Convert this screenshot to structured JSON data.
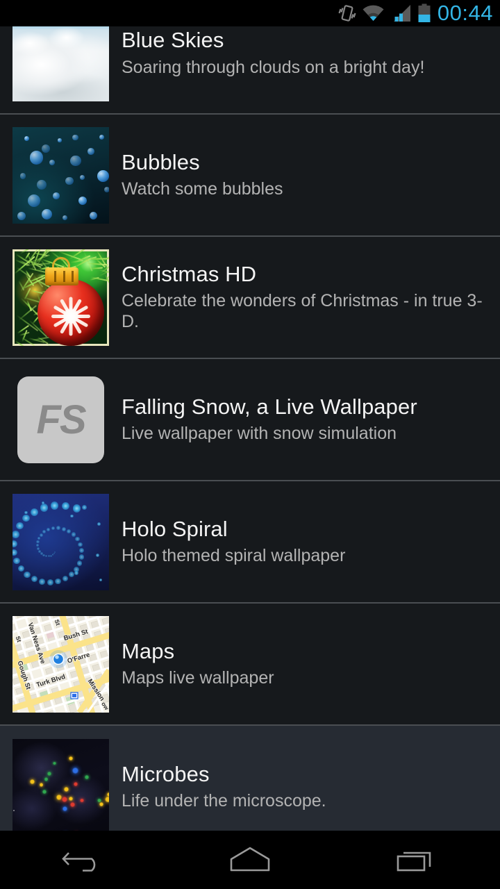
{
  "statusbar": {
    "clock": "00:44",
    "icons": [
      {
        "name": "vibrate-icon",
        "label": "vibrate"
      },
      {
        "name": "wifi-icon",
        "label": "wifi"
      },
      {
        "name": "cellular-signal-icon",
        "label": "signal"
      },
      {
        "name": "battery-icon",
        "label": "battery"
      }
    ],
    "accent_color": "#33b5e5",
    "battery_level_percent": 45
  },
  "list": {
    "items": [
      {
        "title": "Blue Skies",
        "subtitle": "Soaring through clouds on a bright day!",
        "thumb": "blue-skies-thumbnail",
        "selected": false
      },
      {
        "title": "Bubbles",
        "subtitle": "Watch some bubbles",
        "thumb": "bubbles-thumbnail",
        "selected": false
      },
      {
        "title": "Christmas HD",
        "subtitle": "Celebrate the wonders of Christmas - in true 3-D.",
        "thumb": "christmas-hd-thumbnail",
        "selected": false
      },
      {
        "title": "Falling Snow, a Live Wallpaper",
        "subtitle": "Live wallpaper with snow simulation",
        "thumb": "falling-snow-thumbnail",
        "icon_text": "FS",
        "selected": false
      },
      {
        "title": "Holo Spiral",
        "subtitle": "Holo themed spiral wallpaper",
        "thumb": "holo-spiral-thumbnail",
        "selected": false
      },
      {
        "title": "Maps",
        "subtitle": "Maps live wallpaper",
        "thumb": "maps-thumbnail",
        "map_labels": [
          "St",
          "Van Ness Ave",
          "Bush St",
          "O'Farre",
          "Turk Blvd",
          "Gough St",
          "Mission",
          "St",
          "ow"
        ],
        "selected": false
      },
      {
        "title": "Microbes",
        "subtitle": "Life under the microscope.",
        "thumb": "microbes-thumbnail",
        "selected": true
      }
    ]
  },
  "navbar": {
    "buttons": [
      {
        "name": "back-button",
        "label": "Back"
      },
      {
        "name": "home-button",
        "label": "Home"
      },
      {
        "name": "recent-apps-button",
        "label": "Recent apps"
      }
    ]
  },
  "colors": {
    "row_background": "#16191c",
    "row_selected_background": "#262b33",
    "divider": "#4a4e52",
    "title_text": "#f4f4f4",
    "subtitle_text": "#b3b3b3",
    "holo_blue": "#33b5e5"
  }
}
